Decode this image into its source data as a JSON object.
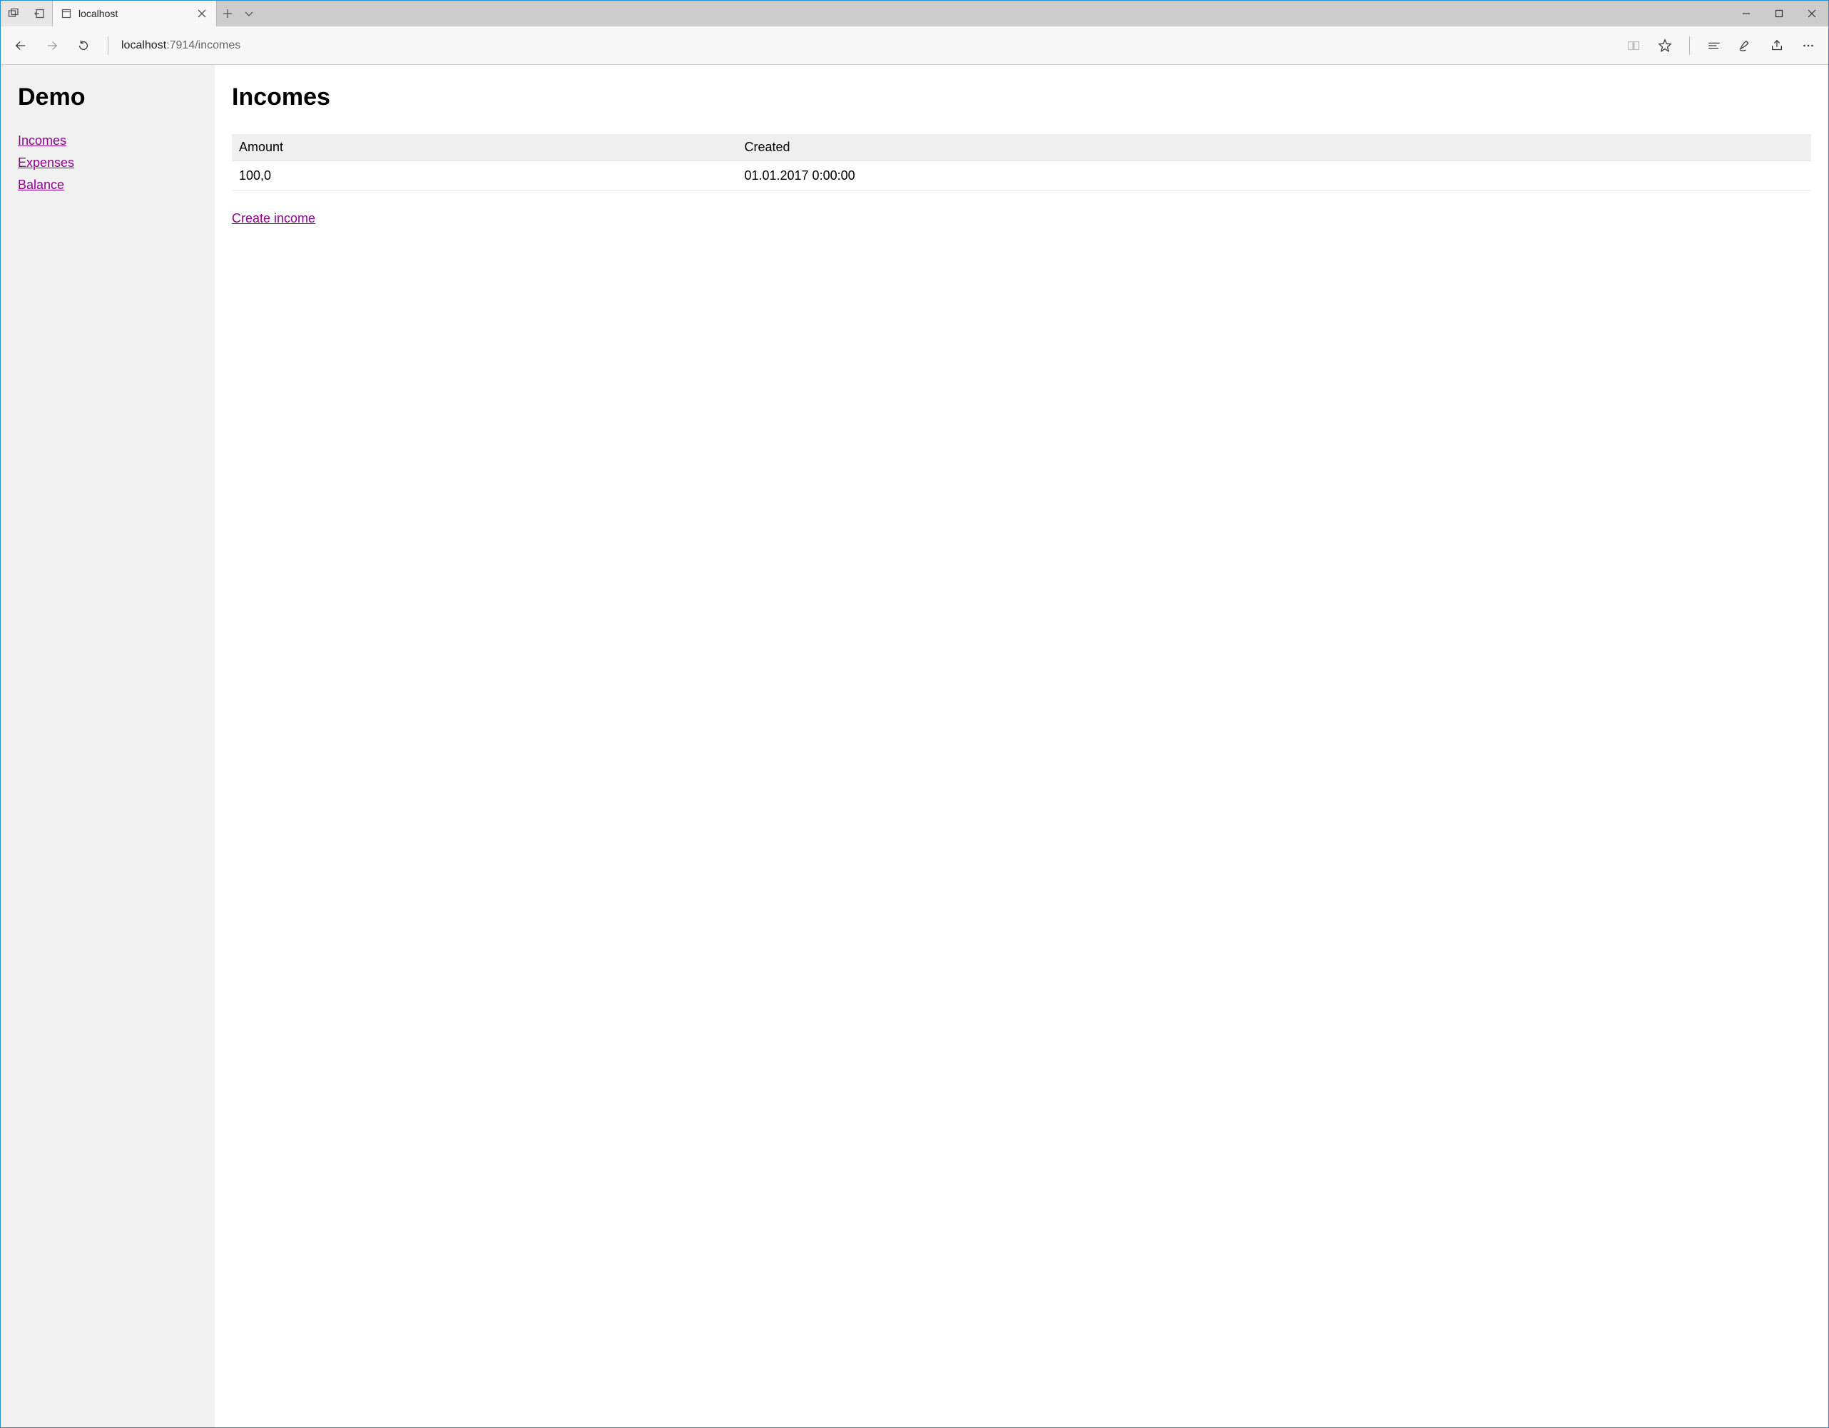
{
  "colors": {
    "link": "#900090"
  },
  "browser": {
    "tab_title": "localhost",
    "url_host": "localhost",
    "url_rest": ":7914/incomes"
  },
  "sidebar": {
    "heading": "Demo",
    "links": [
      {
        "label": "Incomes"
      },
      {
        "label": "Expenses"
      },
      {
        "label": "Balance"
      }
    ]
  },
  "main": {
    "heading": "Incomes",
    "columns": [
      "Amount",
      "Created"
    ],
    "rows": [
      {
        "amount": "100,0",
        "created": "01.01.2017 0:00:00"
      }
    ],
    "create_label": "Create income"
  }
}
